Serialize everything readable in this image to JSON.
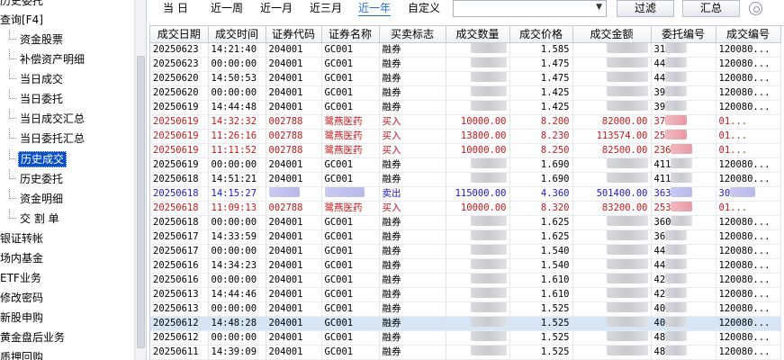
{
  "sidebar": {
    "top_items": [
      {
        "label": "历史委托"
      },
      {
        "label": "查询[F4]"
      }
    ],
    "child_items": [
      {
        "label": "资金股票"
      },
      {
        "label": "补偿资产明细"
      },
      {
        "label": "当日成交"
      },
      {
        "label": "当日委托"
      },
      {
        "label": "当日成交汇总"
      },
      {
        "label": "当日委托汇总"
      },
      {
        "label": "历史成交",
        "active": true
      },
      {
        "label": "历史委托"
      },
      {
        "label": "资金明细"
      },
      {
        "label": "交 割 单"
      }
    ],
    "bottom_items": [
      {
        "label": "银证转帐"
      },
      {
        "label": "场内基金"
      },
      {
        "label": "ETF业务"
      },
      {
        "label": "修改密码"
      },
      {
        "label": "新股申购"
      },
      {
        "label": "黄金盘后业务"
      },
      {
        "label": "质押回购"
      }
    ]
  },
  "toolbar": {
    "periods": [
      {
        "label": "当 日"
      },
      {
        "label": "近一周"
      },
      {
        "label": "近一月"
      },
      {
        "label": "近三月"
      },
      {
        "label": "近一年",
        "active": true
      },
      {
        "label": "自定义"
      }
    ],
    "custom_select_value": "",
    "filter_label": "过滤",
    "summary_label": "汇总",
    "settings_icon": "gear-icon"
  },
  "table": {
    "headers": [
      "成交日期",
      "成交时间",
      "证券代码",
      "证券名称",
      "买卖标志",
      "成交数量",
      "成交价格",
      "成交金额",
      "委托编号",
      "成交编号"
    ],
    "rows": [
      {
        "date": "20250623",
        "time": "14:21:40",
        "code": "204001",
        "name": "GC001",
        "side": "融券",
        "qty": "",
        "price": "1.585",
        "amount": "",
        "order_no": "31",
        "deal_no": "120080...",
        "type": "normal"
      },
      {
        "date": "20250623",
        "time": "00:00:00",
        "code": "204001",
        "name": "GC001",
        "side": "融券",
        "qty": "",
        "price": "1.475",
        "amount": "",
        "order_no": "44",
        "deal_no": "120080...",
        "type": "normal"
      },
      {
        "date": "20250620",
        "time": "14:50:53",
        "code": "204001",
        "name": "GC001",
        "side": "融券",
        "qty": "",
        "price": "1.475",
        "amount": "",
        "order_no": "44",
        "deal_no": "120080...",
        "type": "normal"
      },
      {
        "date": "20250620",
        "time": "00:00:00",
        "code": "204001",
        "name": "GC001",
        "side": "融券",
        "qty": "",
        "price": "1.425",
        "amount": "",
        "order_no": "39",
        "deal_no": "120080...",
        "type": "normal"
      },
      {
        "date": "20250619",
        "time": "14:44:48",
        "code": "204001",
        "name": "GC001",
        "side": "融券",
        "qty": "",
        "price": "1.425",
        "amount": "",
        "order_no": "39",
        "deal_no": "120080...",
        "type": "normal"
      },
      {
        "date": "20250619",
        "time": "14:32:32",
        "code": "002788",
        "name": "鹭燕医药",
        "side": "买入",
        "qty": "10000.00",
        "price": "8.200",
        "amount": "82000.00",
        "order_no": "37",
        "deal_no": "01...",
        "type": "buy"
      },
      {
        "date": "20250619",
        "time": "11:26:16",
        "code": "002788",
        "name": "鹭燕医药",
        "side": "买入",
        "qty": "13800.00",
        "price": "8.230",
        "amount": "113574.00",
        "order_no": "25",
        "deal_no": "01...",
        "type": "buy"
      },
      {
        "date": "20250619",
        "time": "11:11:52",
        "code": "002788",
        "name": "鹭燕医药",
        "side": "买入",
        "qty": "10000.00",
        "price": "8.250",
        "amount": "82500.00",
        "order_no": "236",
        "deal_no": "01...",
        "type": "buy"
      },
      {
        "date": "20250619",
        "time": "00:00:00",
        "code": "204001",
        "name": "GC001",
        "side": "融券",
        "qty": "",
        "price": "1.690",
        "amount": "",
        "order_no": "411",
        "deal_no": "120080...",
        "type": "normal"
      },
      {
        "date": "20250618",
        "time": "14:51:21",
        "code": "204001",
        "name": "GC001",
        "side": "融券",
        "qty": "",
        "price": "1.690",
        "amount": "",
        "order_no": "411",
        "deal_no": "120080...",
        "type": "normal"
      },
      {
        "date": "20250618",
        "time": "14:15:27",
        "code": "",
        "name": "",
        "side": "卖出",
        "qty": "115000.00",
        "price": "4.360",
        "amount": "501400.00",
        "order_no": "363",
        "deal_no": "30",
        "type": "sell"
      },
      {
        "date": "20250618",
        "time": "11:09:13",
        "code": "002788",
        "name": "鹭燕医药",
        "side": "买入",
        "qty": "10000.00",
        "price": "8.320",
        "amount": "83200.00",
        "order_no": "253",
        "deal_no": "01...",
        "type": "buy"
      },
      {
        "date": "20250618",
        "time": "00:00:00",
        "code": "204001",
        "name": "GC001",
        "side": "融券",
        "qty": "",
        "price": "1.625",
        "amount": "",
        "order_no": "360",
        "deal_no": "120080...",
        "type": "normal"
      },
      {
        "date": "20250617",
        "time": "14:33:59",
        "code": "204001",
        "name": "GC001",
        "side": "融券",
        "qty": "",
        "price": "1.625",
        "amount": "",
        "order_no": "36",
        "deal_no": "120080...",
        "type": "normal"
      },
      {
        "date": "20250617",
        "time": "00:00:00",
        "code": "204001",
        "name": "GC001",
        "side": "融券",
        "qty": "",
        "price": "1.540",
        "amount": "",
        "order_no": "44",
        "deal_no": "120080...",
        "type": "normal"
      },
      {
        "date": "20250616",
        "time": "14:34:23",
        "code": "204001",
        "name": "GC001",
        "side": "融券",
        "qty": "",
        "price": "1.540",
        "amount": "",
        "order_no": "44",
        "deal_no": "120080...",
        "type": "normal"
      },
      {
        "date": "20250616",
        "time": "00:00:00",
        "code": "204001",
        "name": "GC001",
        "side": "融券",
        "qty": "",
        "price": "1.610",
        "amount": "",
        "order_no": "42",
        "deal_no": "120080...",
        "type": "normal"
      },
      {
        "date": "20250613",
        "time": "14:44:46",
        "code": "204001",
        "name": "GC001",
        "side": "融券",
        "qty": "",
        "price": "1.610",
        "amount": "",
        "order_no": "42",
        "deal_no": "120080...",
        "type": "normal"
      },
      {
        "date": "20250613",
        "time": "00:00:00",
        "code": "204001",
        "name": "GC001",
        "side": "融券",
        "qty": "",
        "price": "1.525",
        "amount": "",
        "order_no": "40",
        "deal_no": "120080...",
        "type": "normal"
      },
      {
        "date": "20250612",
        "time": "14:48:28",
        "code": "204001",
        "name": "GC001",
        "side": "融券",
        "qty": "",
        "price": "1.525",
        "amount": "",
        "order_no": "40",
        "deal_no": "120080...",
        "type": "selected"
      },
      {
        "date": "20250612",
        "time": "00:00:00",
        "code": "204001",
        "name": "GC001",
        "side": "融券",
        "qty": "",
        "price": "1.525",
        "amount": "",
        "order_no": "48",
        "deal_no": "120080...",
        "type": "normal"
      },
      {
        "date": "20250611",
        "time": "14:39:09",
        "code": "204001",
        "name": "GC001",
        "side": "融券",
        "qty": "",
        "price": "1.525",
        "amount": "",
        "order_no": "48",
        "deal_no": "120080...",
        "type": "normal"
      }
    ]
  }
}
